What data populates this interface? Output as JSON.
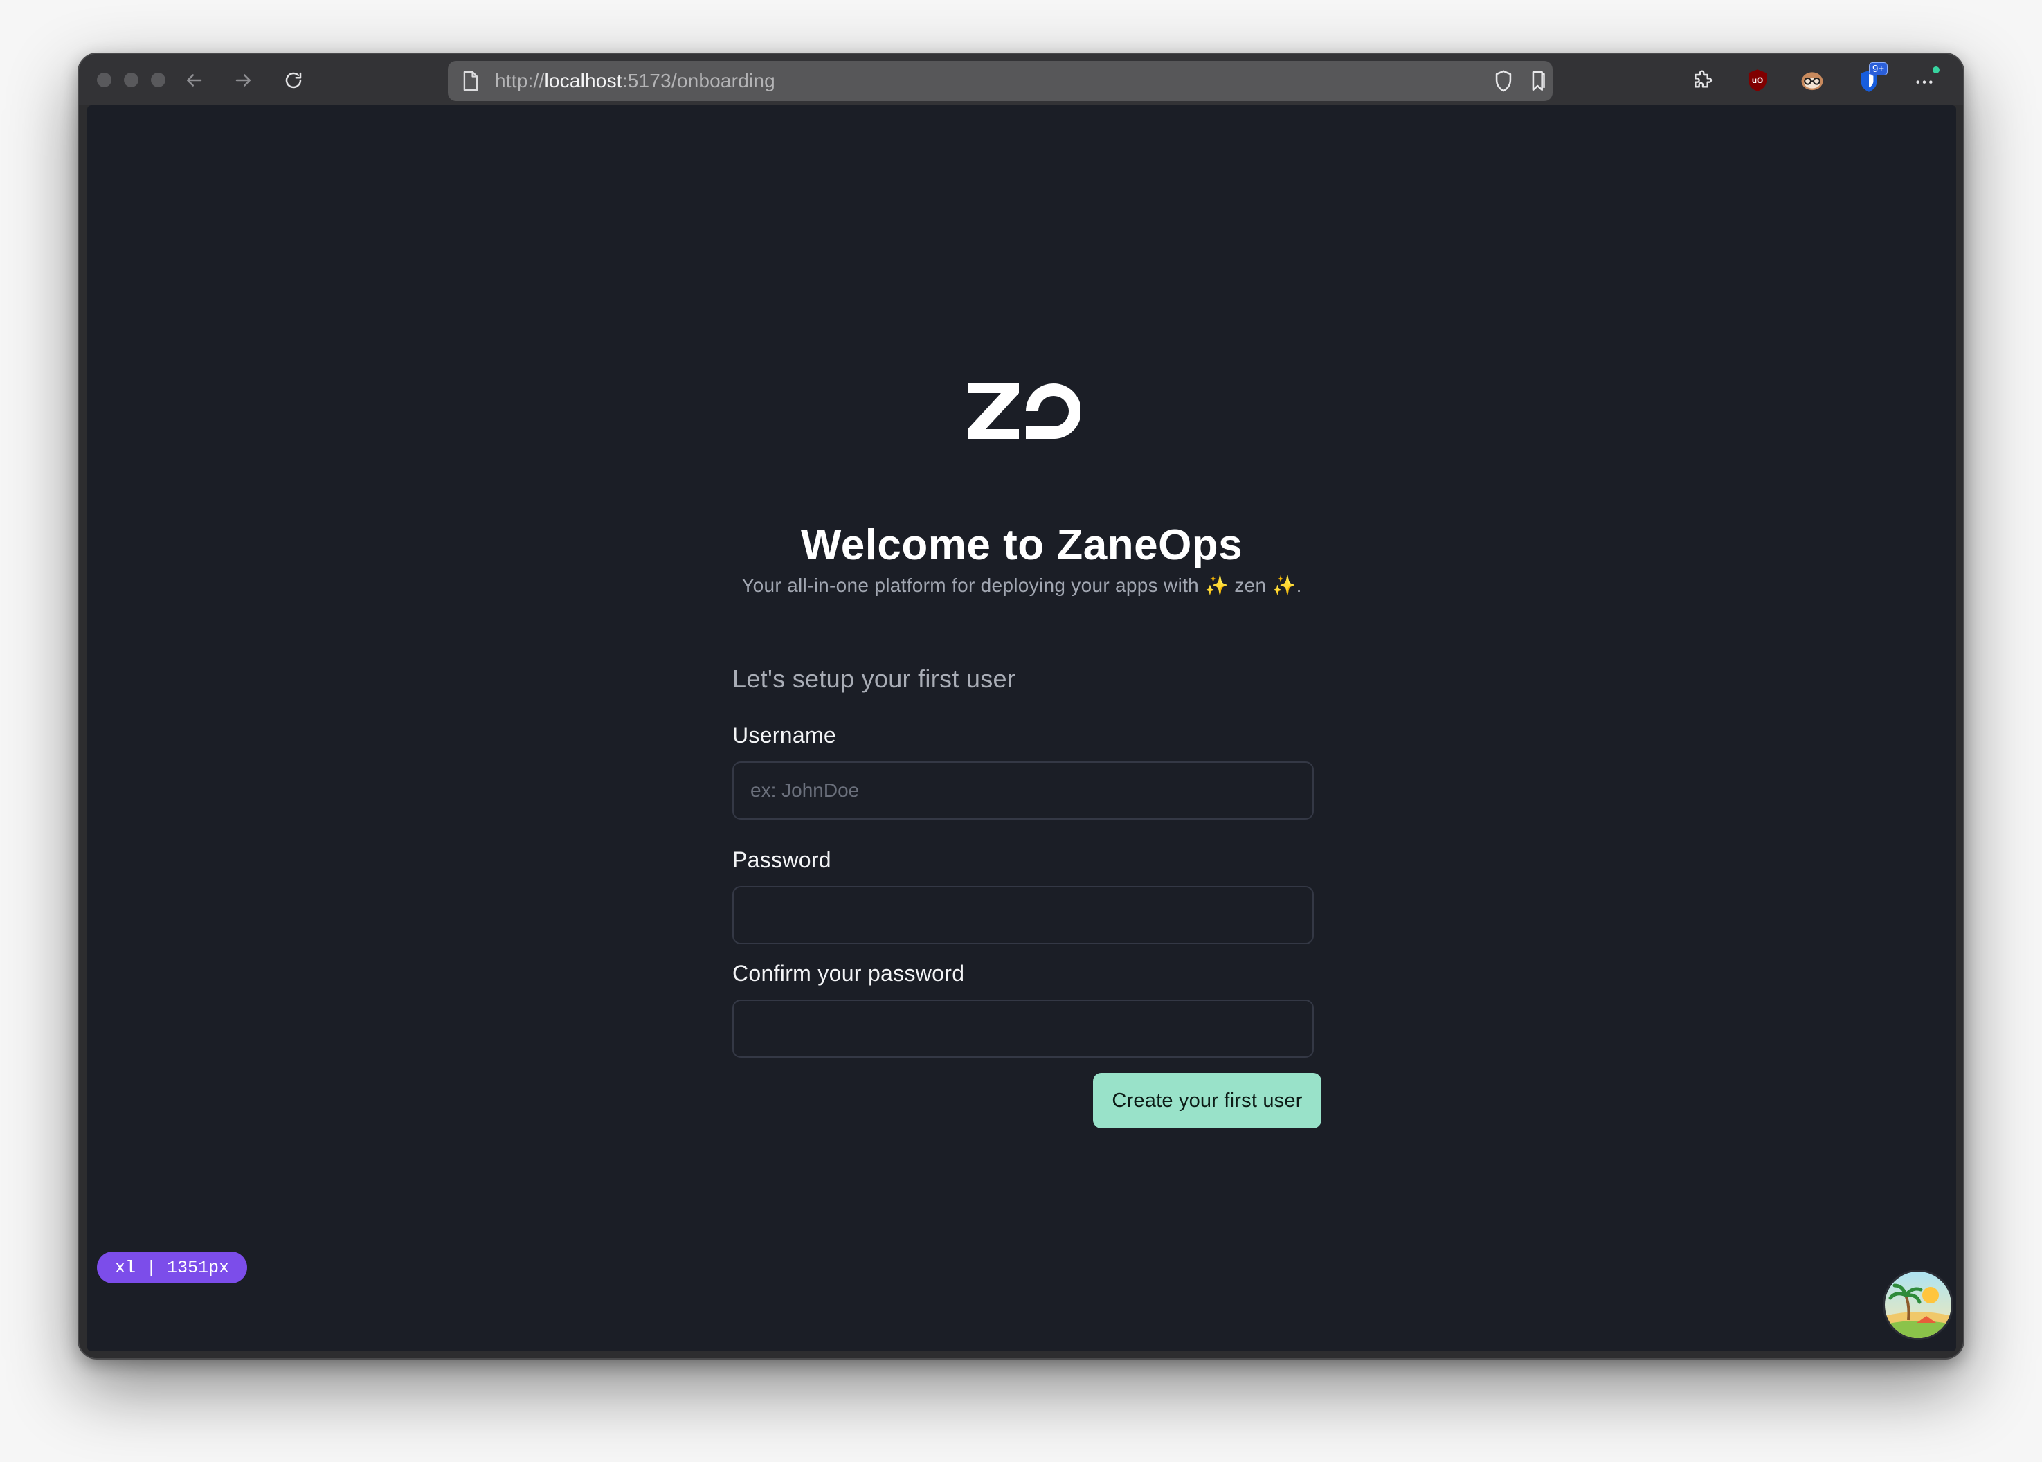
{
  "browser": {
    "url_scheme": "http://",
    "url_host": "localhost",
    "url_rest": ":5173/onboarding",
    "notification_count": "9+",
    "icons": [
      "back-arrow-icon",
      "forward-arrow-icon",
      "reload-icon",
      "page-icon",
      "shield-icon",
      "bookmark-icon",
      "extensions-puzzle-icon",
      "ublock-icon",
      "privacy-badger-icon",
      "bitwarden-icon",
      "more-menu-icon"
    ]
  },
  "page": {
    "logo_alt": "ZO",
    "welcome_title": "Welcome to ZaneOps",
    "subtitle": "Your all-in-one platform for deploying your apps with ✨ zen ✨.",
    "setup_heading": "Let's setup your first user",
    "username_label": "Username",
    "username_placeholder": "ex: JohnDoe",
    "username_value": "",
    "password_label": "Password",
    "password_value": "",
    "confirm_label": "Confirm your password",
    "confirm_value": "",
    "submit_label": "Create your first user"
  },
  "overlay": {
    "breakpoint_badge": "xl | 1351px"
  },
  "colors": {
    "background": "#1b1e26",
    "accent_button": "#99e2c9",
    "badge": "#7c4dea"
  }
}
